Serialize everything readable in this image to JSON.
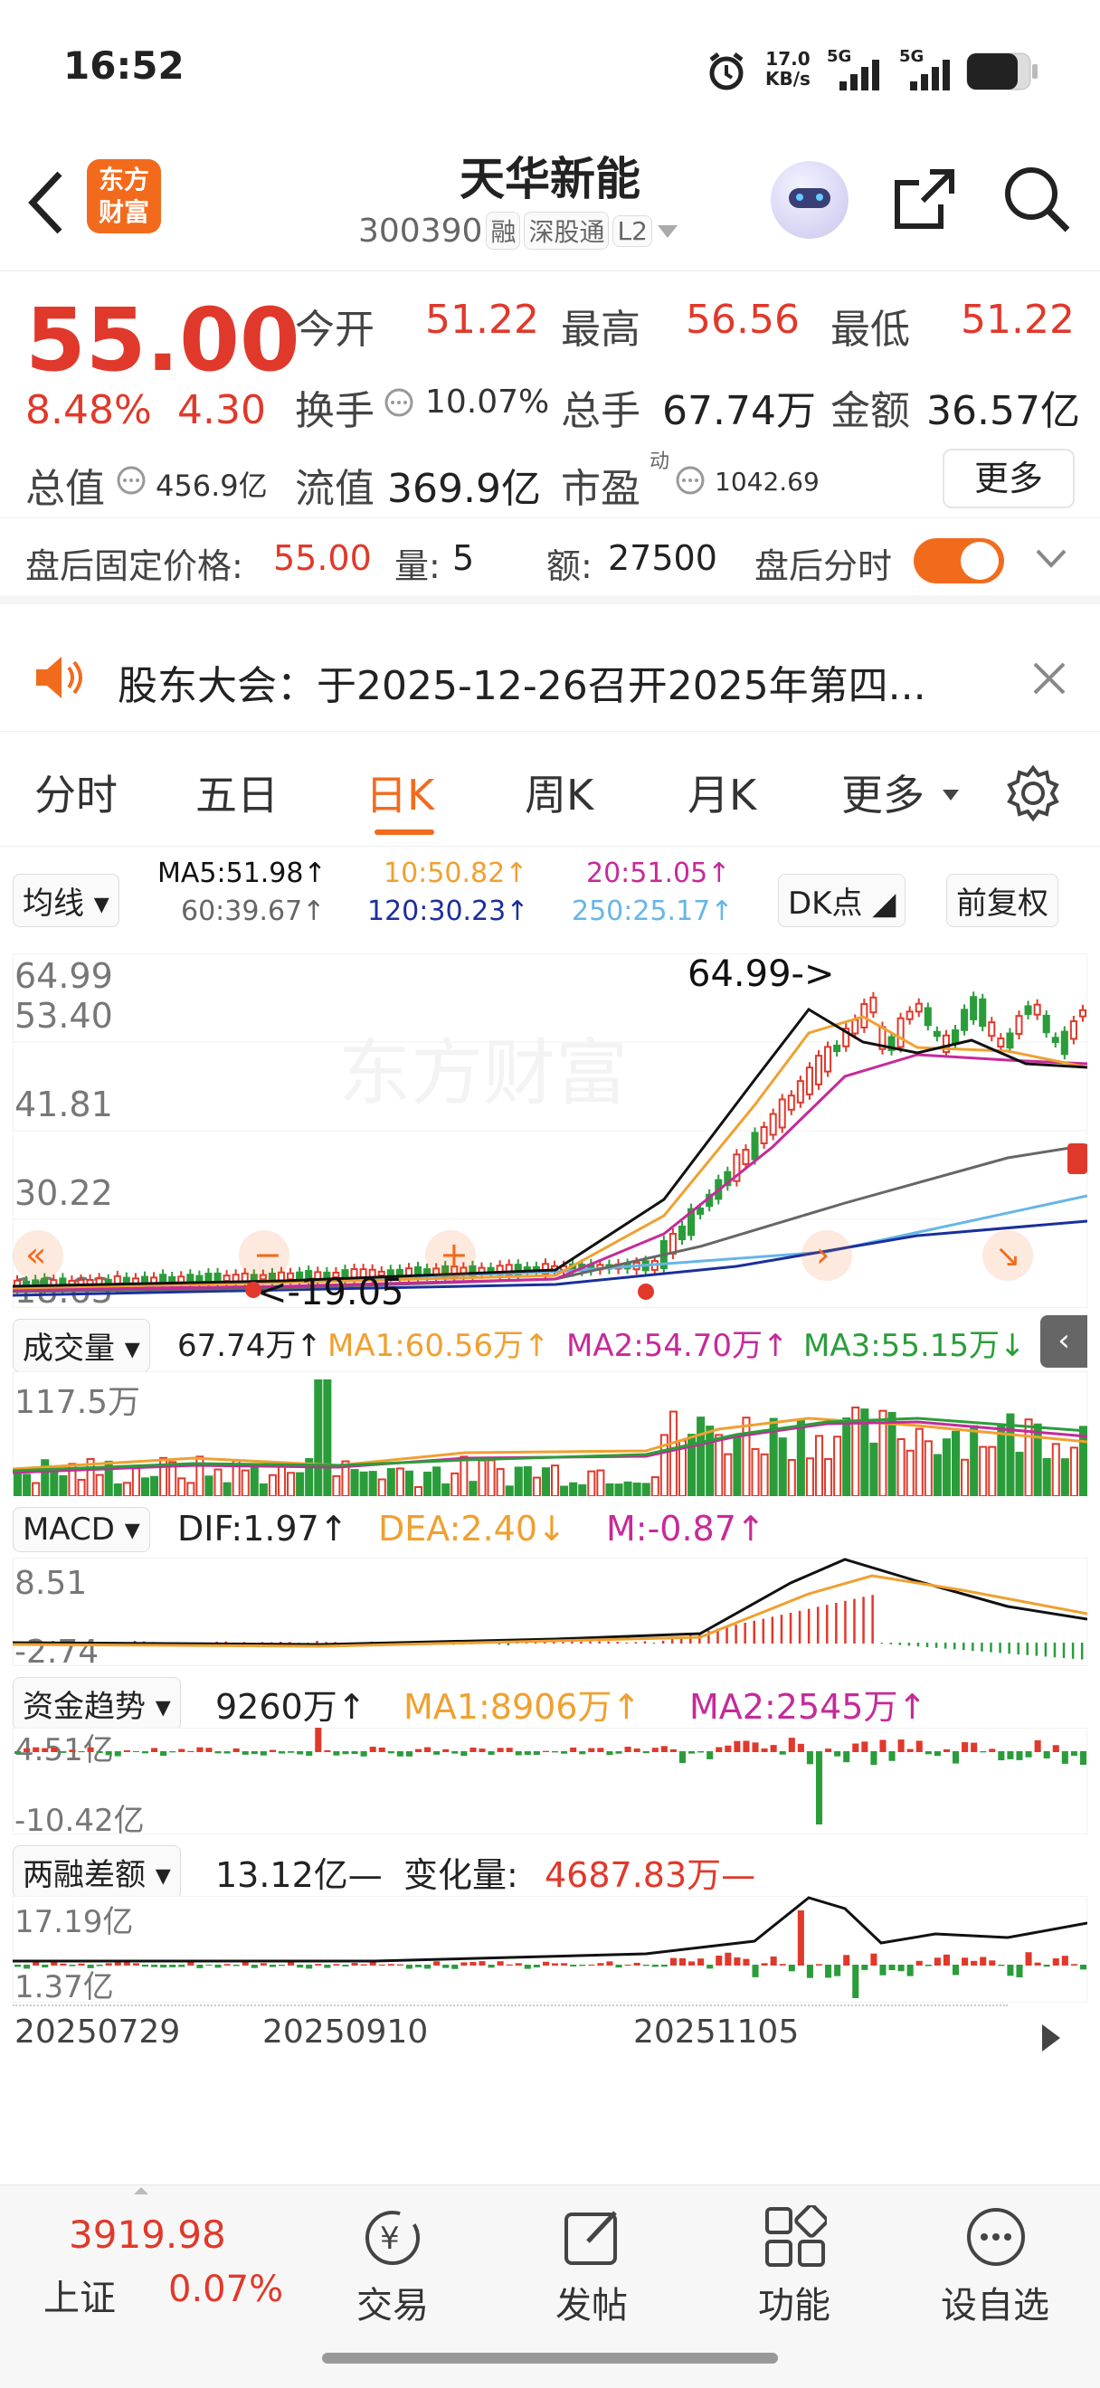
{
  "status": {
    "time": "16:52",
    "speed_top": "17.0",
    "speed_bot": "KB/s",
    "net1": "5G",
    "net2": "5G"
  },
  "header": {
    "logo_line1": "东方",
    "logo_line2": "财富",
    "title": "天华新能",
    "code": "300390",
    "tags": [
      "融",
      "深股通",
      "L2"
    ]
  },
  "quote": {
    "price": "55.00",
    "change_pct": "8.48%",
    "change": "4.30",
    "open_label": "今开",
    "open": "51.22",
    "high_label": "最高",
    "high": "56.56",
    "low_label": "最低",
    "low": "51.22",
    "turnover_label": "换手",
    "turnover": "10.07%",
    "volume_label": "总手",
    "volume": "67.74万",
    "amount_label": "金额",
    "amount": "36.57亿",
    "mktcap_label": "总值",
    "mktcap": "456.9亿",
    "float_label": "流值",
    "float": "369.9亿",
    "pe_label": "市盈",
    "pe_sup": "动",
    "pe": "1042.69",
    "more": "更多"
  },
  "after": {
    "label": "盘后固定价格:",
    "price": "55.00",
    "vol_label": "量:",
    "vol": "5",
    "amt_label": "额:",
    "amt": "27500",
    "toggle_label": "盘后分时"
  },
  "notice": {
    "text": "股东大会：于2025-12-26召开2025年第四..."
  },
  "tabs": [
    "分时",
    "五日",
    "日K",
    "周K",
    "月K",
    "更多"
  ],
  "active_tab": "日K",
  "ma": {
    "select": "均线",
    "ma5": "MA5:51.98",
    "ma10": "10:50.82",
    "ma20": "20:51.05",
    "ma60": "60:39.67",
    "ma120": "120:30.23",
    "ma250": "250:25.17",
    "dk": "DK点",
    "fq": "前复权",
    "arrow": "↑"
  },
  "kline": {
    "y_labels": [
      "64.99",
      "53.40",
      "41.81",
      "30.22",
      "18.63"
    ],
    "max_label": "64.99->",
    "min_label": "<-19.05",
    "watermark": "东方财富"
  },
  "volume": {
    "select": "成交量",
    "val": "67.74万",
    "ma1": "MA1:60.56万",
    "ma2": "MA2:54.70万",
    "ma3": "MA3:55.15万",
    "y_label": "117.5万"
  },
  "macd": {
    "select": "MACD",
    "dif": "DIF:1.97",
    "dea": "DEA:2.40",
    "m": "M:-0.87",
    "y_top": "8.51",
    "y_bot": "-2.74"
  },
  "fund": {
    "select": "资金趋势",
    "val": "9260万",
    "ma1": "MA1:8906万",
    "ma2": "MA2:2545万",
    "y_top": "4.51亿",
    "y_bot": "-10.42亿"
  },
  "margin": {
    "select": "两融差额",
    "val": "13.12亿—",
    "chg_label": "变化量:",
    "chg": "4687.83万—",
    "y_top": "17.19亿",
    "y_bot": "1.37亿"
  },
  "dates": [
    "20250729",
    "20250910",
    "20251105"
  ],
  "bottom": {
    "index_val": "3919.98",
    "index_name": "上证",
    "index_pct": "0.07%",
    "nav": [
      "交易",
      "发帖",
      "功能",
      "设自选"
    ]
  },
  "colors": {
    "up": "#e0392b",
    "down": "#2a9d3a",
    "accent": "#f26b1d",
    "ma5": "#111111",
    "ma10": "#f0a030",
    "ma20": "#c62a9a",
    "ma60": "#666666",
    "ma120": "#1a2f9c",
    "ma250": "#66b6e8"
  }
}
